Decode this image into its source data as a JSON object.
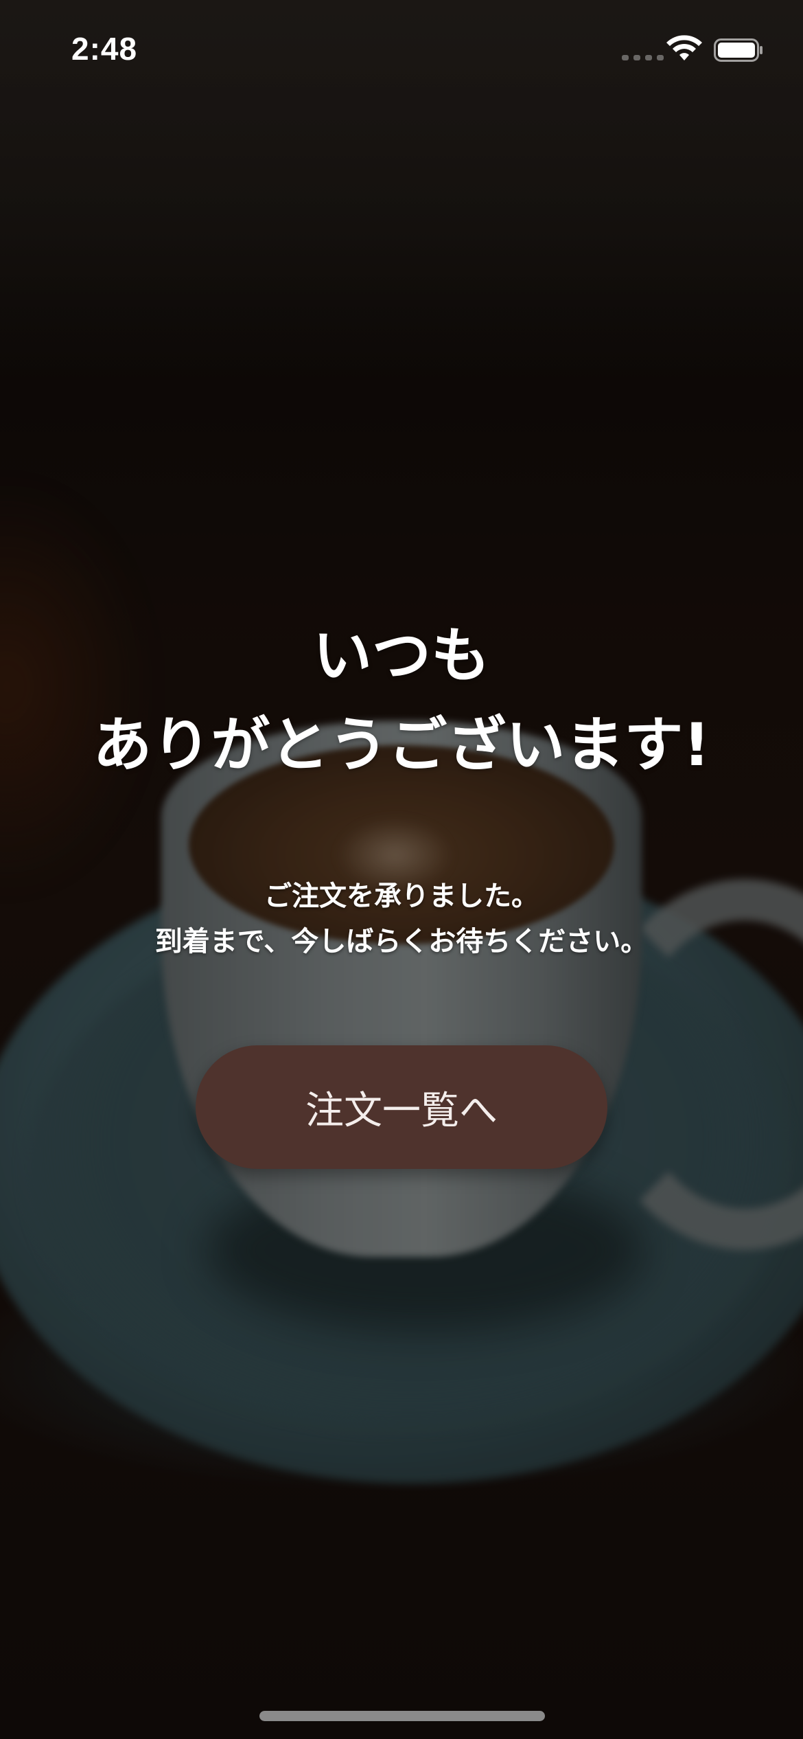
{
  "status_bar": {
    "time": "2:48",
    "icons": [
      "signal-icon",
      "wifi-icon",
      "battery-icon"
    ]
  },
  "main": {
    "title_lines": [
      "いつも",
      "ありがとうございます!"
    ],
    "message_lines": [
      "ご注文を承りました。",
      "到着まで、今しばらくお待ちください。"
    ],
    "order_list_button_label": "注文一覧へ"
  },
  "colors": {
    "button_background": "#4f332d",
    "text": "#ffffff"
  }
}
